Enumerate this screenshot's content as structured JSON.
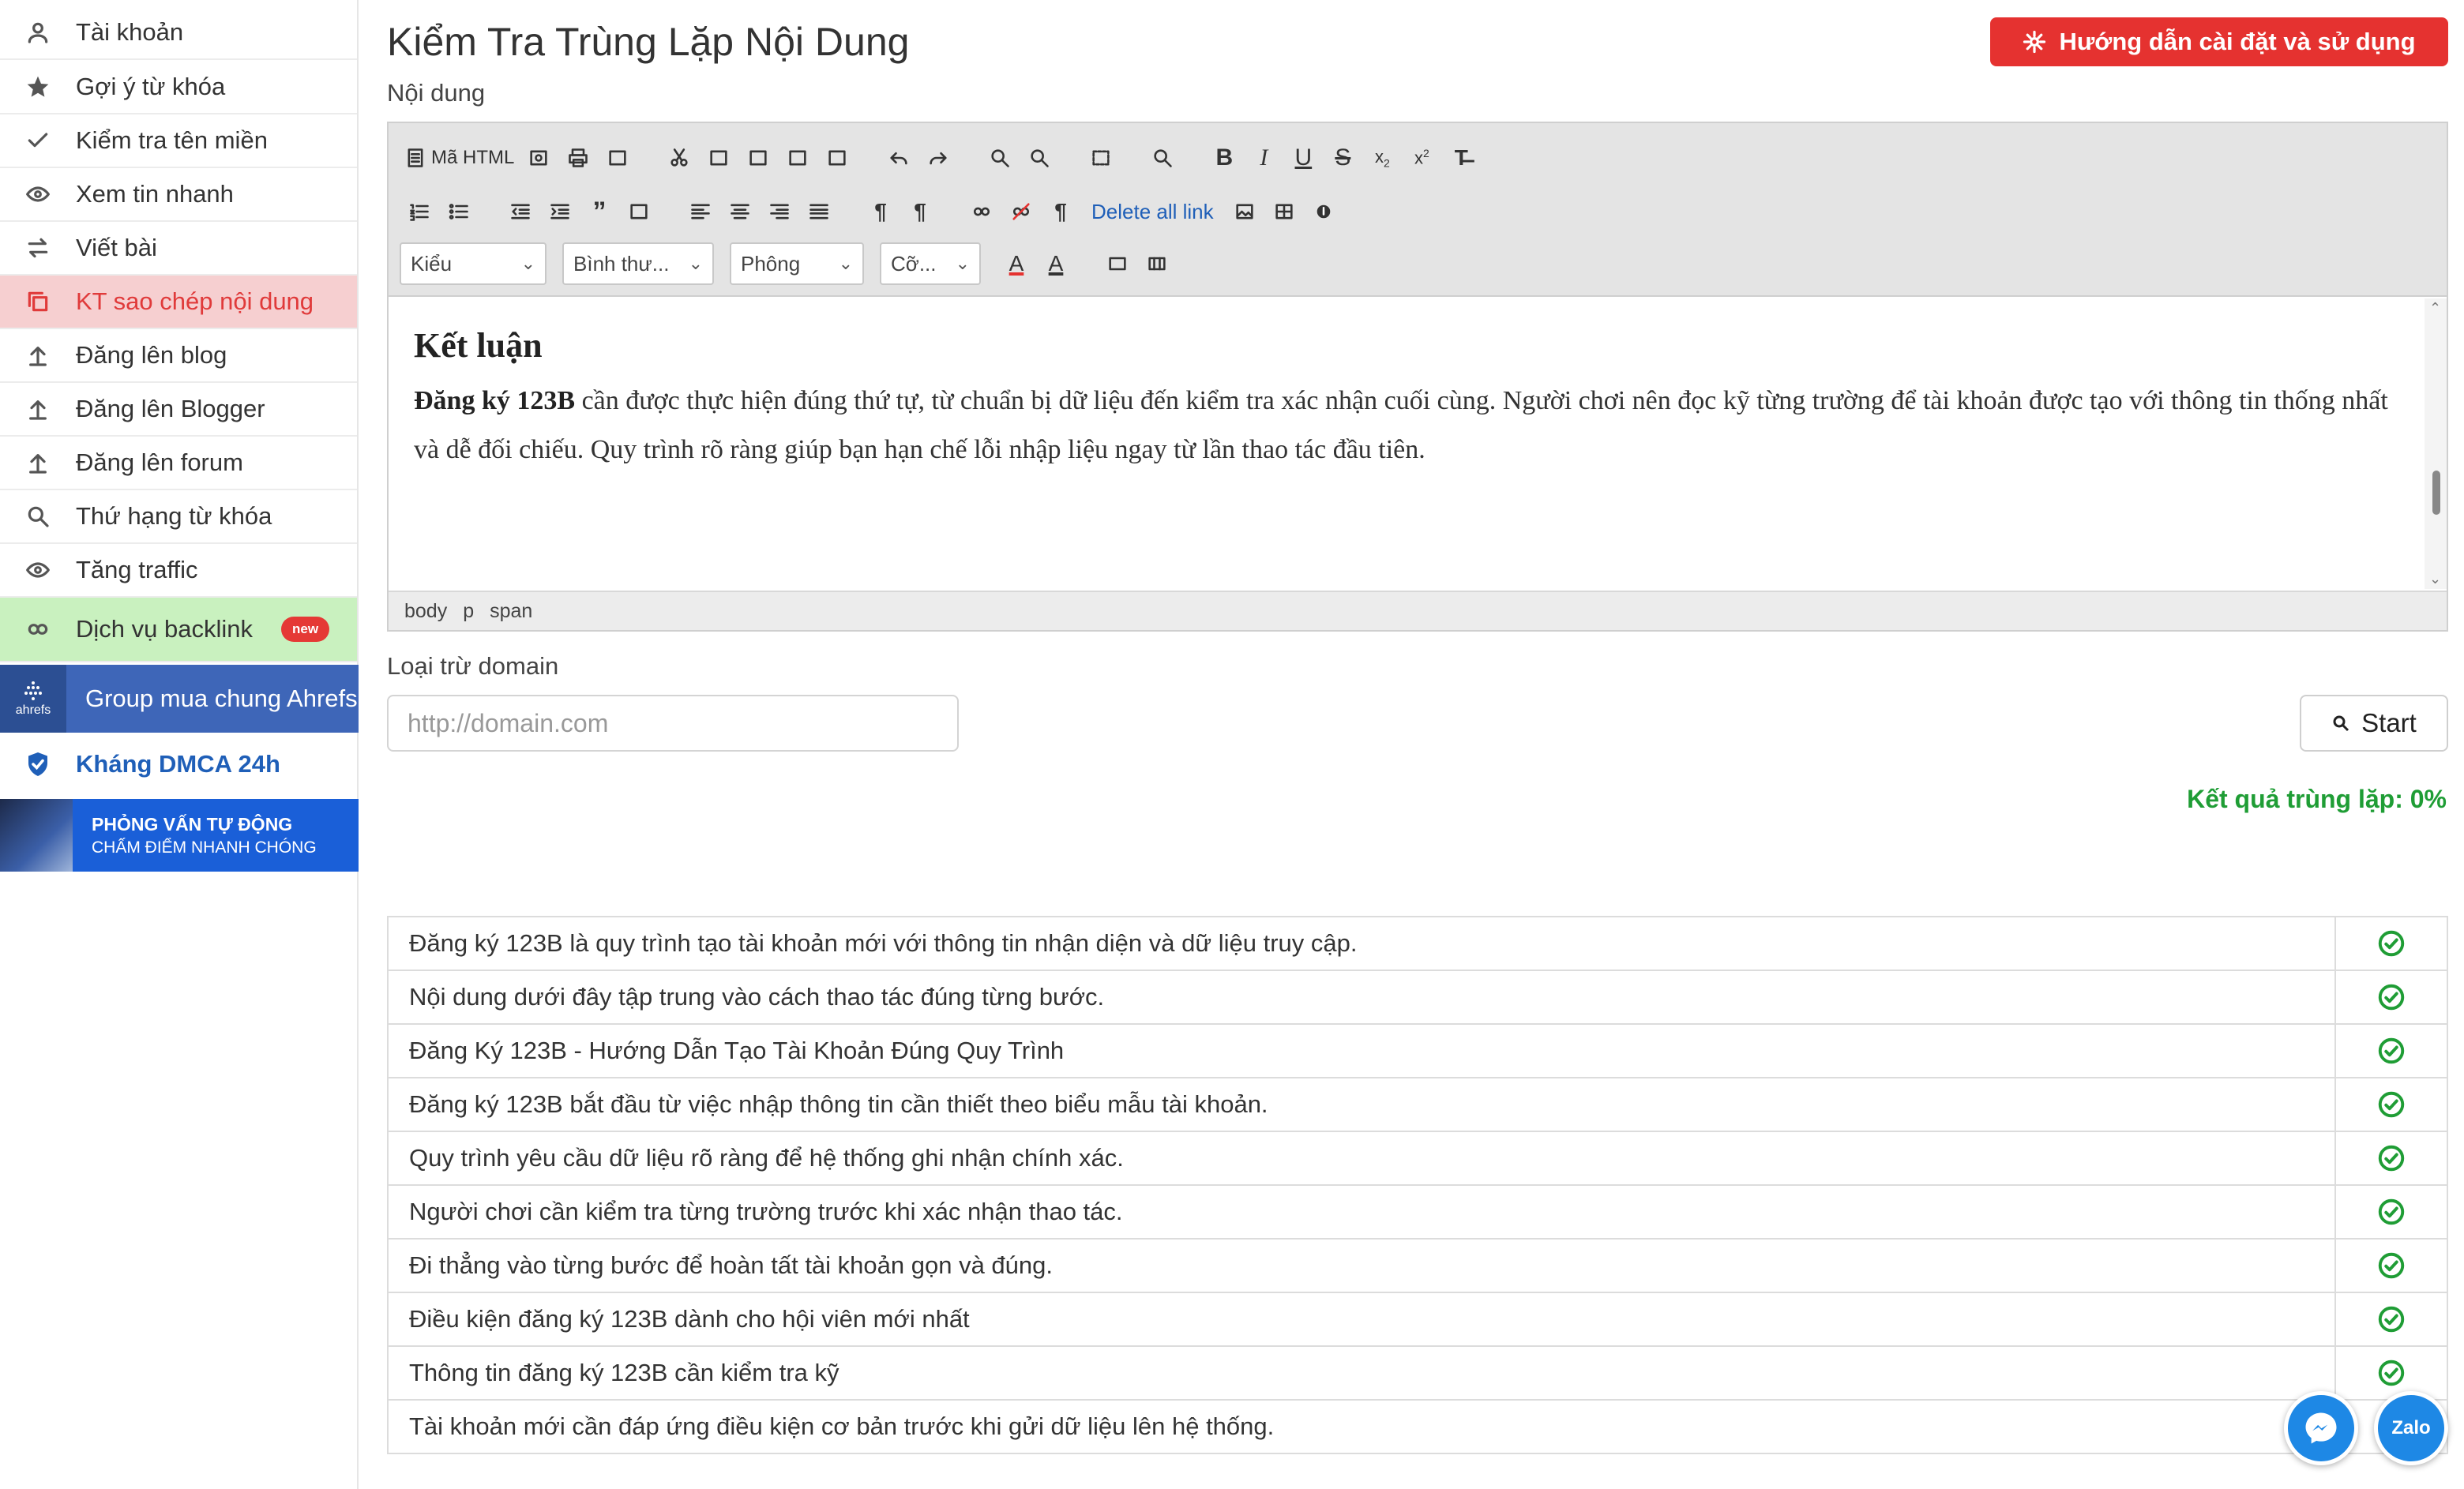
{
  "sidebar": {
    "items": [
      {
        "label": "Tài khoản",
        "icon": "user-icon"
      },
      {
        "label": "Gợi ý từ khóa",
        "icon": "star-icon"
      },
      {
        "label": "Kiểm tra tên miền",
        "icon": "check-icon"
      },
      {
        "label": "Xem tin nhanh",
        "icon": "eye-icon"
      },
      {
        "label": "Viết bài",
        "icon": "swap-icon"
      },
      {
        "label": "KT sao chép nội dung",
        "icon": "copy-icon",
        "active": true
      },
      {
        "label": "Đăng lên blog",
        "icon": "upload-icon"
      },
      {
        "label": "Đăng lên Blogger",
        "icon": "upload-icon"
      },
      {
        "label": "Đăng lên forum",
        "icon": "upload-icon"
      },
      {
        "label": "Thứ hạng từ khóa",
        "icon": "search-icon"
      },
      {
        "label": "Tăng traffic",
        "icon": "eye-icon"
      },
      {
        "label": "Dịch vụ backlink",
        "icon": "link-icon",
        "badge": "new"
      }
    ],
    "ahrefs": {
      "logo_text": "ahrefs",
      "label": "Group mua chung Ahrefs"
    },
    "dmca": {
      "label": "Kháng DMCA 24h"
    },
    "banner": {
      "line1": "PHỎNG VẤN TỰ ĐỘNG",
      "line2": "CHẤM ĐIỂM NHANH CHÓNG"
    }
  },
  "header": {
    "title": "Kiểm Tra Trùng Lặp Nội Dung",
    "guide_button": "Hướng dẫn cài đặt và sử dụng"
  },
  "content_label": "Nội dung",
  "editor": {
    "source_label": "Mã HTML",
    "delete_links": "Delete all link",
    "selects": {
      "style": "Kiểu",
      "format": "Bình thư...",
      "font": "Phông",
      "size": "Cỡ..."
    },
    "heading": "Kết luận",
    "para_bold": "Đăng ký 123B",
    "para_text": " cần được thực hiện đúng thứ tự, từ chuẩn bị dữ liệu đến kiểm tra xác nhận cuối cùng. Người chơi nên đọc kỹ từng trường để tài khoản được tạo với thông tin thống nhất và dễ đối chiếu. Quy trình rõ ràng giúp bạn hạn chế lỗi nhập liệu ngay từ lần thao tác đầu tiên.",
    "path": [
      "body",
      "p",
      "span"
    ]
  },
  "exclude": {
    "label": "Loại trừ domain",
    "placeholder": "http://domain.com",
    "start_button": "Start"
  },
  "result_label": "Kết quả trùng lặp: 0%",
  "results": [
    "Đăng ký 123B là quy trình tạo tài khoản mới với thông tin nhận diện và dữ liệu truy cập.",
    "Nội dung dưới đây tập trung vào cách thao tác đúng từng bước.",
    "Đăng Ký 123B - Hướng Dẫn Tạo Tài Khoản Đúng Quy Trình",
    "Đăng ký 123B bắt đầu từ việc nhập thông tin cần thiết theo biểu mẫu tài khoản.",
    "Quy trình yêu cầu dữ liệu rõ ràng để hệ thống ghi nhận chính xác.",
    "Người chơi cần kiểm tra từng trường trước khi xác nhận thao tác.",
    "Đi thẳng vào từng bước để hoàn tất tài khoản gọn và đúng.",
    "Điều kiện đăng ký 123B dành cho hội viên mới nhất",
    "Thông tin đăng ký 123B cần kiểm tra kỹ",
    "Tài khoản mới cần đáp ứng điều kiện cơ bản trước khi gửi dữ liệu lên hệ thống."
  ],
  "chat": {
    "zalo_label": "Zalo"
  },
  "colors": {
    "accent_red": "#e53230",
    "active_bg": "#f6cfd0",
    "success_green": "#1f9d35",
    "link_blue": "#1f5fb8"
  }
}
